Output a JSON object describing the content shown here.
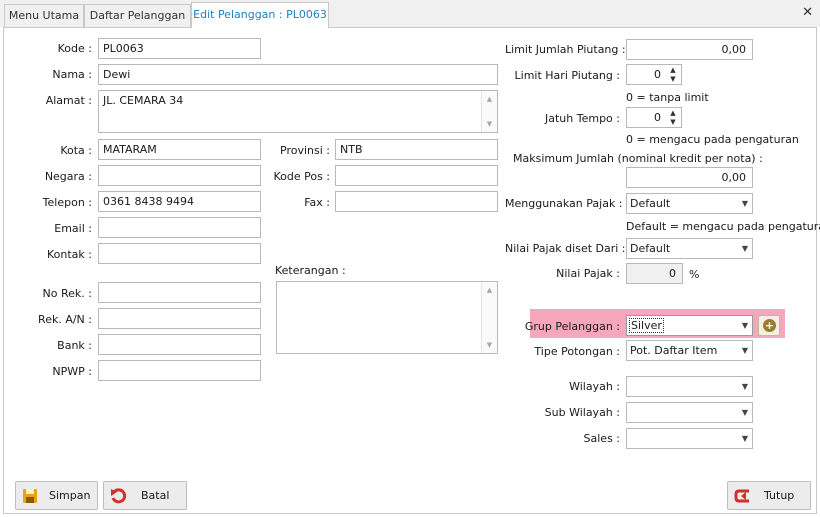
{
  "tabs": [
    {
      "label": "Menu Utama"
    },
    {
      "label": "Daftar Pelanggan"
    },
    {
      "label": "Edit Pelanggan : PL0063"
    }
  ],
  "close_icon": "close-icon",
  "form": {
    "kode": {
      "label": "Kode :",
      "value": "PL0063"
    },
    "nama": {
      "label": "Nama :",
      "value": "Dewi"
    },
    "alamat": {
      "label": "Alamat :",
      "value": "JL. CEMARA 34"
    },
    "kota": {
      "label": "Kota :",
      "value": "MATARAM"
    },
    "provinsi": {
      "label": "Provinsi :",
      "value": "NTB"
    },
    "negara": {
      "label": "Negara :",
      "value": ""
    },
    "kode_pos": {
      "label": "Kode Pos :",
      "value": ""
    },
    "telepon": {
      "label": "Telepon :",
      "value": "0361 8438 9494"
    },
    "fax": {
      "label": "Fax :",
      "value": ""
    },
    "email": {
      "label": "Email :",
      "value": ""
    },
    "kontak": {
      "label": "Kontak :",
      "value": ""
    },
    "keterangan": {
      "label": "Keterangan :",
      "value": ""
    },
    "no_rek": {
      "label": "No Rek. :",
      "value": ""
    },
    "rek_an": {
      "label": "Rek. A/N :",
      "value": ""
    },
    "bank": {
      "label": "Bank :",
      "value": ""
    },
    "npwp": {
      "label": "NPWP :",
      "value": ""
    }
  },
  "credit": {
    "limit_jumlah": {
      "label": "Limit Jumlah Piutang :",
      "value": "0,00"
    },
    "limit_hari": {
      "label": "Limit Hari Piutang :",
      "value": "0",
      "note": "0 = tanpa limit"
    },
    "jatuh_tempo": {
      "label": "Jatuh Tempo :",
      "value": "0",
      "note": "0 = mengacu pada pengaturan"
    },
    "maks_jumlah": {
      "label": "Maksimum Jumlah (nominal kredit per nota) :",
      "value": "0,00"
    },
    "pajak": {
      "label": "Menggunakan Pajak :",
      "value": "Default",
      "note": "Default = mengacu pada pengaturan"
    },
    "nilai_pajak_dari": {
      "label": "Nilai Pajak diset Dari :",
      "value": "Default"
    },
    "nilai_pajak": {
      "label": "Nilai Pajak :",
      "value": "0",
      "unit": "%"
    },
    "grup": {
      "label": "Grup Pelanggan :",
      "value": "Silver",
      "highlight_color": "#f6a6bd"
    },
    "tipe_potongan": {
      "label": "Tipe Potongan :",
      "value": "Pot. Daftar Item"
    },
    "wilayah": {
      "label": "Wilayah :",
      "value": ""
    },
    "sub_wilayah": {
      "label": "Sub Wilayah :",
      "value": ""
    },
    "sales": {
      "label": "Sales :",
      "value": ""
    }
  },
  "buttons": {
    "simpan": {
      "label": "Simpan",
      "icon": "save-icon"
    },
    "batal": {
      "label": "Batal",
      "icon": "undo-icon"
    },
    "tutup": {
      "label": "Tutup",
      "icon": "exit-icon"
    }
  },
  "colors": {
    "active_tab": "#1e7fc2",
    "highlight": "#f6a6bd",
    "icon_red": "#d0312d",
    "icon_gold": "#e8a317"
  }
}
